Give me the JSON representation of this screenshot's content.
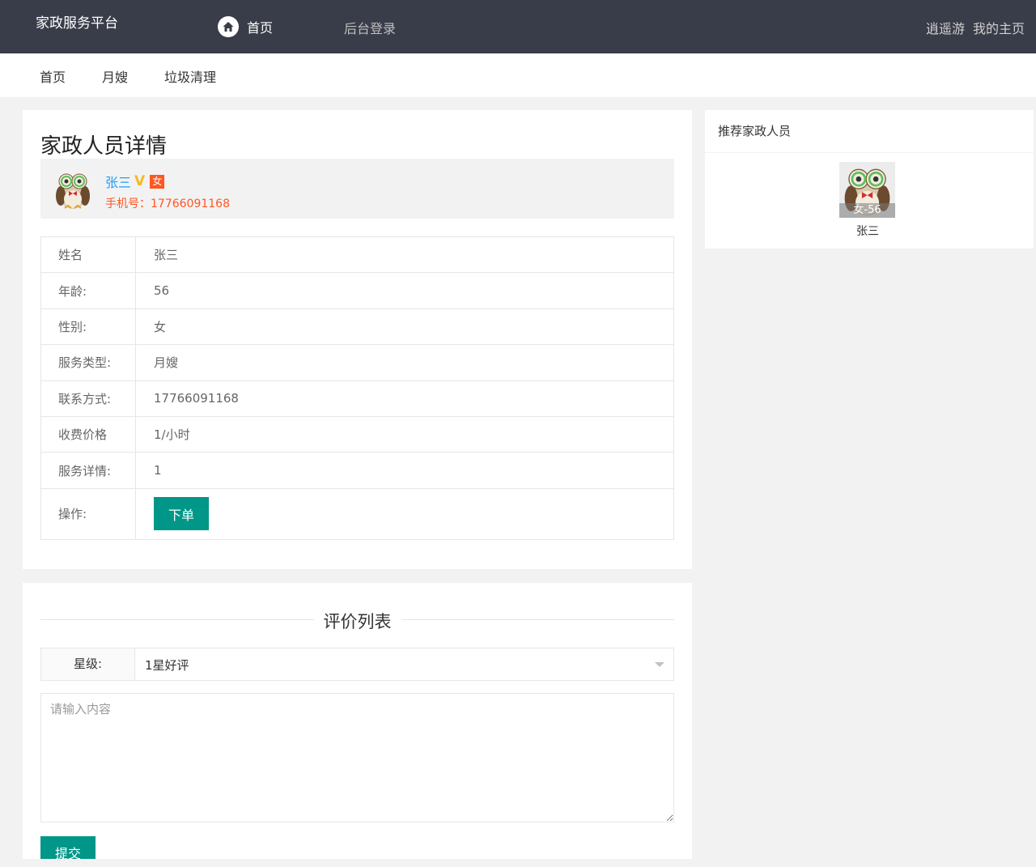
{
  "header": {
    "brand": "家政服务平台",
    "nav_home": "首页",
    "nav_login": "后台登录",
    "user_name": "逍遥游",
    "my_home": "我的主页"
  },
  "subnav": {
    "items": [
      "首页",
      "月嫂",
      "垃圾清理"
    ]
  },
  "detail": {
    "title": "家政人员详情",
    "profile": {
      "name": "张三",
      "verified_mark": "V",
      "sex_badge": "女",
      "phone_label": "手机号：",
      "phone": "17766091168"
    },
    "rows": [
      {
        "label": "姓名",
        "value": "张三"
      },
      {
        "label": "年龄:",
        "value": "56"
      },
      {
        "label": "性别:",
        "value": "女"
      },
      {
        "label": "服务类型:",
        "value": "月嫂"
      },
      {
        "label": "联系方式:",
        "value": "17766091168"
      },
      {
        "label": "收费价格",
        "value": "1/小时"
      },
      {
        "label": "服务详情:",
        "value": "1"
      }
    ],
    "operation_label": "操作:",
    "order_button": "下单"
  },
  "recommend": {
    "title": "推荐家政人员",
    "items": [
      {
        "tag": "女-56",
        "name": "张三"
      }
    ]
  },
  "review": {
    "title": "评价列表",
    "star_label": "星级:",
    "star_selected": "1星好评",
    "placeholder": "请输入内容",
    "submit": "提交"
  },
  "colors": {
    "topbar": "#393d49",
    "accent": "#009688",
    "link": "#1e9fff",
    "warn": "#ff5722",
    "verified": "#f7b824"
  }
}
